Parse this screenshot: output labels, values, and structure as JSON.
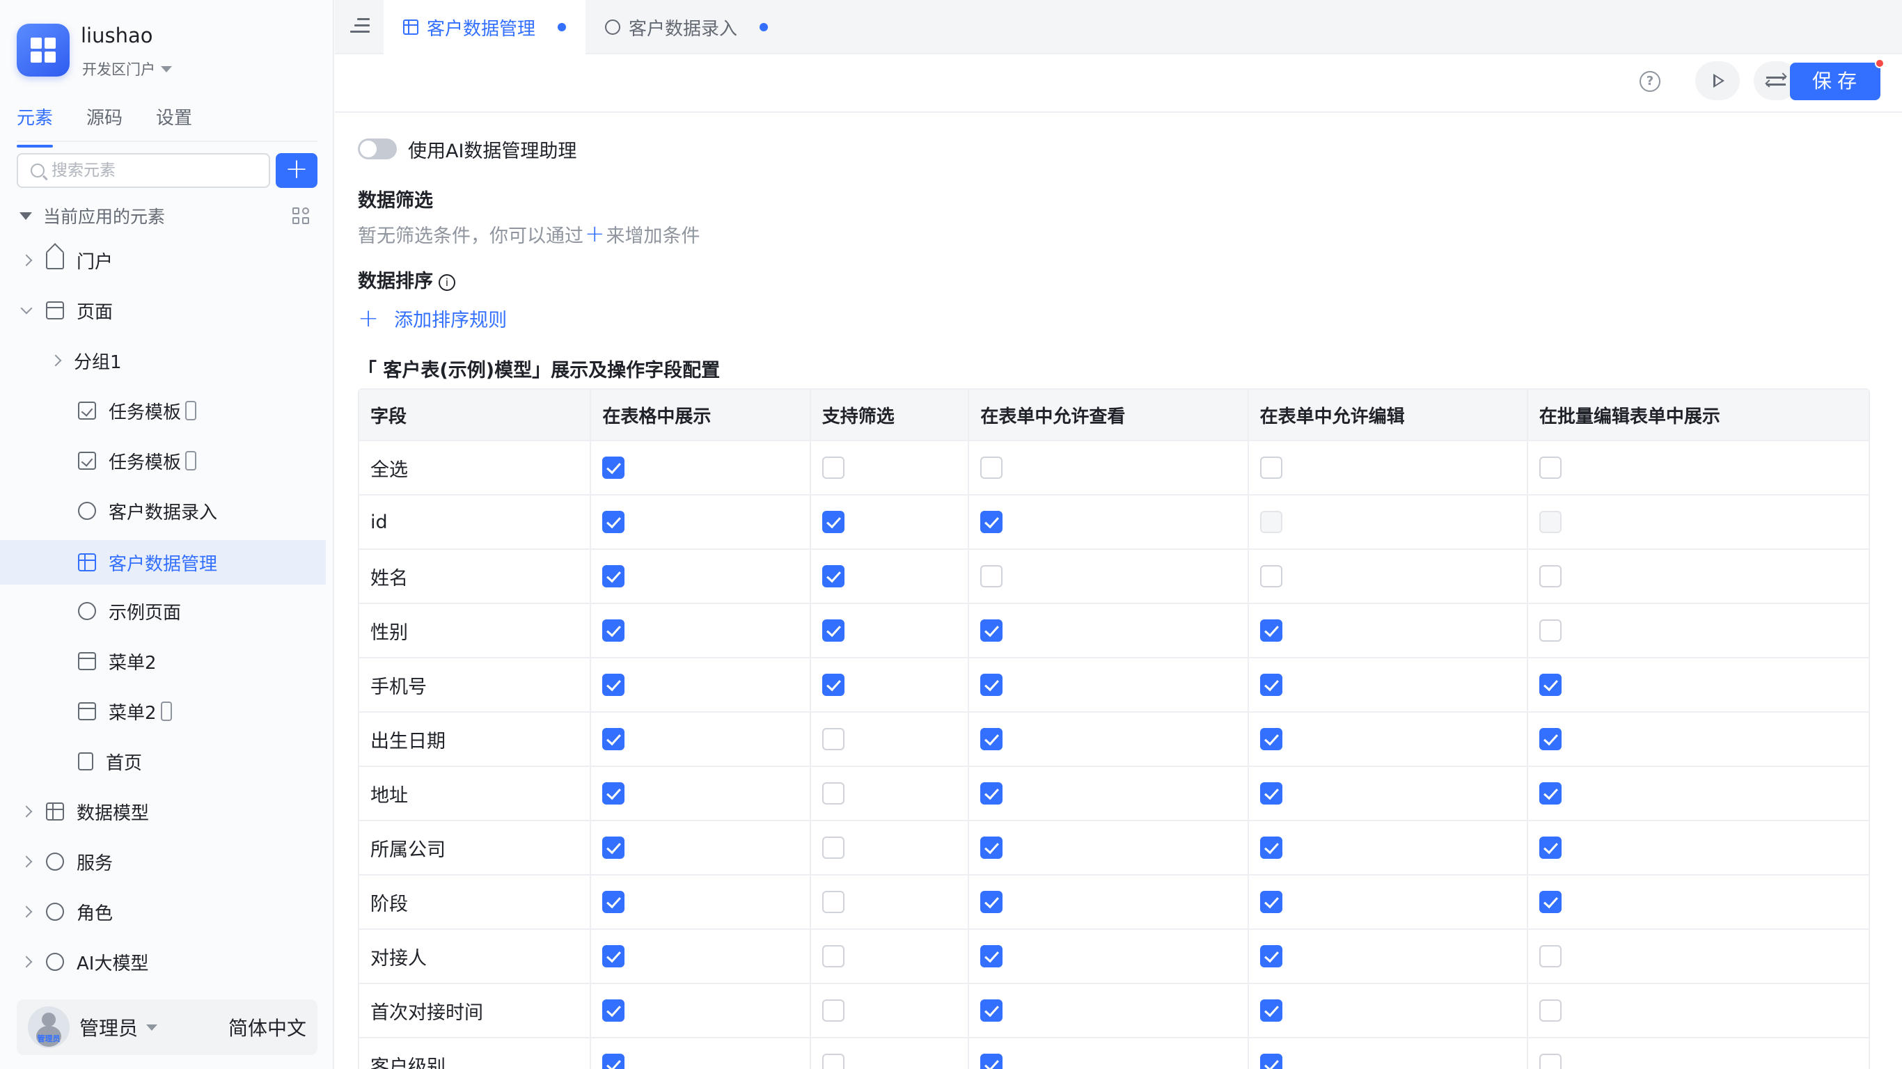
{
  "app": {
    "name": "liushao",
    "portal": "开发区门户"
  },
  "sidebar": {
    "tabs": [
      "元素",
      "源码",
      "设置"
    ],
    "search_placeholder": "搜索元素",
    "section_title": "当前应用的元素",
    "tree": [
      {
        "label": "门户",
        "icon": "home-icon"
      },
      {
        "label": "页面",
        "icon": "pages-icon"
      },
      {
        "label": "分组1",
        "icon": ""
      },
      {
        "label": "任务模板",
        "icon": "task-icon"
      },
      {
        "label": "任务模板",
        "icon": "task-icon"
      },
      {
        "label": "客户数据录入",
        "icon": "form-icon"
      },
      {
        "label": "客户数据管理",
        "icon": "table-icon"
      },
      {
        "label": "示例页面",
        "icon": "form-icon"
      },
      {
        "label": "菜单2",
        "icon": "window-icon"
      },
      {
        "label": "菜单2",
        "icon": "window-icon"
      },
      {
        "label": "首页",
        "icon": "doc-icon"
      },
      {
        "label": "数据模型",
        "icon": "data-model-icon"
      },
      {
        "label": "服务",
        "icon": "service-icon"
      },
      {
        "label": "角色",
        "icon": "role-icon"
      },
      {
        "label": "AI大模型",
        "icon": "ai-model-icon"
      }
    ],
    "user": {
      "name": "管理员",
      "avatar_label": "管理员",
      "language": "简体中文"
    }
  },
  "tabs": [
    {
      "label": "客户数据管理",
      "active": true
    },
    {
      "label": "客户数据录入",
      "active": false
    }
  ],
  "toolbar": {
    "save_label": "保存"
  },
  "content": {
    "ai_toggle_label": "使用AI数据管理助理",
    "filter_title": "数据筛选",
    "filter_hint_before": "暂无筛选条件，你可以通过",
    "filter_hint_after": "来增加条件",
    "sort_title": "数据排序",
    "add_sort_label": "添加排序规则",
    "config_title": "「 客户表(示例)模型」展示及操作字段配置"
  },
  "table": {
    "columns": [
      "字段",
      "在表格中展示",
      "支持筛选",
      "在表单中允许查看",
      "在表单中允许编辑",
      "在批量编辑表单中展示"
    ],
    "rows": [
      {
        "field": "全选",
        "checks": [
          true,
          false,
          false,
          false,
          false
        ]
      },
      {
        "field": "id",
        "checks": [
          true,
          true,
          true,
          "disabled",
          "disabled"
        ]
      },
      {
        "field": "姓名",
        "checks": [
          true,
          true,
          false,
          false,
          false
        ]
      },
      {
        "field": "性别",
        "checks": [
          true,
          true,
          true,
          true,
          false
        ]
      },
      {
        "field": "手机号",
        "checks": [
          true,
          true,
          true,
          true,
          true
        ]
      },
      {
        "field": "出生日期",
        "checks": [
          true,
          false,
          true,
          true,
          true
        ]
      },
      {
        "field": "地址",
        "checks": [
          true,
          false,
          true,
          true,
          true
        ]
      },
      {
        "field": "所属公司",
        "checks": [
          true,
          false,
          true,
          true,
          true
        ]
      },
      {
        "field": "阶段",
        "checks": [
          true,
          false,
          true,
          true,
          true
        ]
      },
      {
        "field": "对接人",
        "checks": [
          true,
          false,
          true,
          true,
          false
        ]
      },
      {
        "field": "首次对接时间",
        "checks": [
          true,
          false,
          true,
          true,
          false
        ]
      },
      {
        "field": "客户级别",
        "checks": [
          true,
          false,
          true,
          true,
          false
        ]
      }
    ]
  }
}
